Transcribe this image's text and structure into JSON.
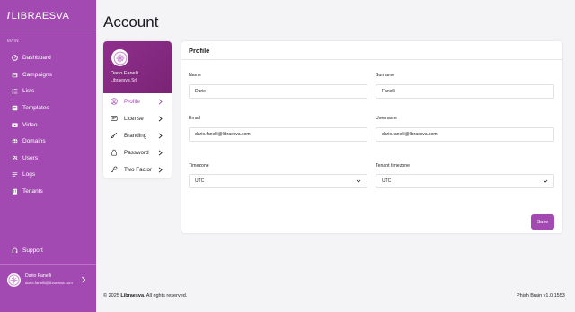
{
  "sidebar": {
    "logo_text": "LIBRAESVA",
    "section_label": "MAIN",
    "items": [
      {
        "label": "Dashboard",
        "icon": "dashboard-icon"
      },
      {
        "label": "Campaigns",
        "icon": "calendar-icon"
      },
      {
        "label": "Lists",
        "icon": "list-icon"
      },
      {
        "label": "Templates",
        "icon": "template-icon"
      },
      {
        "label": "Video",
        "icon": "video-icon"
      },
      {
        "label": "Domains",
        "icon": "globe-icon"
      },
      {
        "label": "Users",
        "icon": "users-icon"
      },
      {
        "label": "Logs",
        "icon": "logs-icon"
      },
      {
        "label": "Tenants",
        "icon": "building-icon"
      }
    ],
    "support_label": "Support",
    "user": {
      "name": "Dario Fanelli",
      "email": "dario.fanelli@libraesva.com"
    }
  },
  "page": {
    "title": "Account"
  },
  "profile_card": {
    "name": "Dario Fanelli",
    "company": "Libraesva Srl",
    "menu": [
      {
        "label": "Profile",
        "icon": "user-circle-icon",
        "active": true
      },
      {
        "label": "License",
        "icon": "license-icon",
        "active": false
      },
      {
        "label": "Branding",
        "icon": "brush-icon",
        "active": false
      },
      {
        "label": "Password",
        "icon": "lock-icon",
        "active": false
      },
      {
        "label": "Two Factor",
        "icon": "key-icon",
        "active": false
      }
    ]
  },
  "form": {
    "title": "Profile",
    "name": {
      "label": "Name",
      "value": "Dario"
    },
    "surname": {
      "label": "Surname",
      "value": "Fanelli"
    },
    "email": {
      "label": "Email",
      "value": "dario.fanelli@libraesva.com"
    },
    "username": {
      "label": "Username",
      "value": "dario.fanelli@libraesva.com"
    },
    "timezone": {
      "label": "Timezone",
      "value": "UTC"
    },
    "tenant_timezone": {
      "label": "Tenant timezone",
      "value": "UTC"
    },
    "save_label": "Save"
  },
  "footer": {
    "copyright_prefix": "© 2025 ",
    "brand": "Libraesva",
    "copyright_suffix": ". All rights reserved.",
    "version": "Phish Brain v1.0.1553"
  },
  "colors": {
    "accent": "#a24ab1",
    "accent_dark": "#7a2475",
    "background": "#f4f3f5"
  }
}
